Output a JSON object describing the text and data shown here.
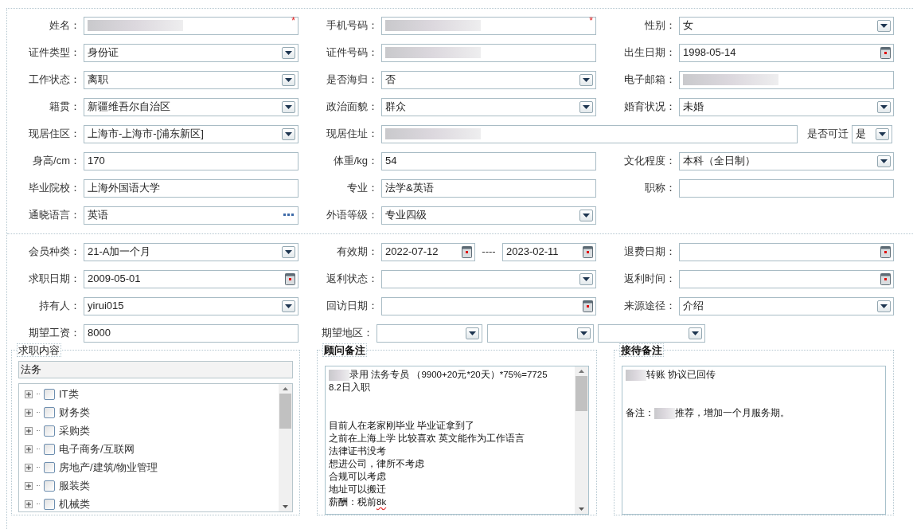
{
  "basic_info": {
    "rows": [
      [
        {
          "label": "姓名：",
          "kind": "text",
          "redacted": true,
          "mark": "*"
        },
        {
          "label": "手机号码：",
          "kind": "text",
          "redacted": true,
          "mark": "*"
        },
        {
          "label": "性别：",
          "kind": "select",
          "value": "女"
        }
      ],
      [
        {
          "label": "证件类型：",
          "kind": "select",
          "value": "身份证"
        },
        {
          "label": "证件号码：",
          "kind": "text",
          "redacted": true
        },
        {
          "label": "出生日期：",
          "kind": "date",
          "value": "1998-05-14"
        }
      ],
      [
        {
          "label": "工作状态：",
          "kind": "select",
          "value": "离职"
        },
        {
          "label": "是否海归：",
          "kind": "select",
          "value": "否"
        },
        {
          "label": "电子邮箱：",
          "kind": "text",
          "redacted": true
        }
      ],
      [
        {
          "label": "籍贯：",
          "kind": "select",
          "value": "新疆维吾尔自治区"
        },
        {
          "label": "政治面貌：",
          "kind": "select",
          "value": "群众"
        },
        {
          "label": "婚育状况：",
          "kind": "select",
          "value": "未婚"
        }
      ],
      [
        {
          "label": "现居住区：",
          "kind": "select",
          "value": "上海市-上海市-[浦东新区]"
        },
        {
          "label": "现居住址：",
          "kind": "wide-text",
          "redacted": true
        },
        {
          "label": "是否可迁",
          "kind": "mini-select",
          "value": "是"
        }
      ],
      [
        {
          "label": "身高/cm：",
          "kind": "text",
          "value": "170"
        },
        {
          "label": "体重/kg：",
          "kind": "text",
          "value": "54"
        },
        {
          "label": "文化程度：",
          "kind": "select",
          "value": "本科（全日制）"
        }
      ],
      [
        {
          "label": "毕业院校：",
          "kind": "text",
          "value": "上海外国语大学"
        },
        {
          "label": "专业：",
          "kind": "text",
          "value": "法学&英语"
        },
        {
          "label": "职称：",
          "kind": "text"
        }
      ],
      [
        {
          "label": "通晓语言：",
          "kind": "dots",
          "value": "英语"
        },
        {
          "label": "外语等级：",
          "kind": "select",
          "value": "专业四级"
        }
      ]
    ]
  },
  "membership": {
    "rows": [
      [
        {
          "label": "会员种类：",
          "kind": "select",
          "value": "21-A加一个月"
        },
        {
          "label": "有效期：",
          "kind": "range",
          "from": "2022-07-12",
          "separator": "----",
          "to": "2023-02-11"
        },
        {
          "label": "退费日期：",
          "kind": "date"
        }
      ],
      [
        {
          "label": "求职日期：",
          "kind": "date",
          "value": "2009-05-01"
        },
        {
          "label": "返利状态：",
          "kind": "select"
        },
        {
          "label": "返利时间：",
          "kind": "date"
        }
      ],
      [
        {
          "label": "持有人：",
          "kind": "select",
          "value": "yirui015"
        },
        {
          "label": "回访日期：",
          "kind": "date"
        },
        {
          "label": "来源途径：",
          "kind": "select",
          "value": "介绍"
        }
      ],
      [
        {
          "label": "期望工资：",
          "kind": "text",
          "value": "8000"
        },
        {
          "label": "期望地区：",
          "kind": "triple-select"
        }
      ]
    ]
  },
  "panels": [
    {
      "kind": "tree",
      "title": "求职内容",
      "filter": "法务",
      "items": [
        {
          "label": "IT类",
          "expanded": false,
          "checked": false
        },
        {
          "label": "财务类",
          "expanded": false,
          "checked": false
        },
        {
          "label": "采购类",
          "expanded": false,
          "checked": false
        },
        {
          "label": "电子商务/互联网",
          "expanded": false,
          "checked": false
        },
        {
          "label": "房地产/建筑/物业管理",
          "expanded": false,
          "checked": false
        },
        {
          "label": "服装类",
          "expanded": false,
          "checked": false
        },
        {
          "label": "机械类",
          "expanded": false,
          "checked": false
        }
      ]
    },
    {
      "kind": "notes",
      "title": "顾问备注",
      "scrollbar": true,
      "lines": [
        {
          "segments": [
            {
              "kind": "redacted"
            },
            {
              "kind": "text",
              "text": "录用 法务专员 （9900+20元*20天）*75%=7725"
            }
          ]
        },
        {
          "segments": [
            {
              "kind": "text",
              "text": "8.2日入职"
            }
          ]
        },
        {
          "kind": "blank"
        },
        {
          "kind": "blank"
        },
        {
          "segments": [
            {
              "kind": "text",
              "text": "目前人在老家刚毕业 毕业证拿到了"
            }
          ]
        },
        {
          "segments": [
            {
              "kind": "text",
              "text": "之前在上海上学 比较喜欢 英文能作为工作语言"
            }
          ]
        },
        {
          "segments": [
            {
              "kind": "text",
              "text": "法律证书没考"
            }
          ]
        },
        {
          "segments": [
            {
              "kind": "text",
              "text": "想进公司，律所不考虑"
            }
          ]
        },
        {
          "segments": [
            {
              "kind": "text",
              "text": "合规可以考虑"
            }
          ]
        },
        {
          "segments": [
            {
              "kind": "text",
              "text": "地址可以搬迁"
            }
          ]
        },
        {
          "segments": [
            {
              "kind": "text",
              "text": "薪酬：税前"
            },
            {
              "kind": "text",
              "text": "8k",
              "misspelled": true
            }
          ]
        }
      ]
    },
    {
      "kind": "notes",
      "title": "接待备注",
      "scrollbar": false,
      "lines": [
        {
          "segments": [
            {
              "kind": "redacted"
            },
            {
              "kind": "text",
              "text": " 转账 协议已回传"
            }
          ]
        },
        {
          "kind": "blank"
        },
        {
          "kind": "blank"
        },
        {
          "segments": [
            {
              "kind": "text",
              "text": "备注："
            },
            {
              "kind": "redacted"
            },
            {
              "kind": "text",
              "text": "推荐，增加一个月服务期。"
            }
          ]
        }
      ]
    }
  ]
}
